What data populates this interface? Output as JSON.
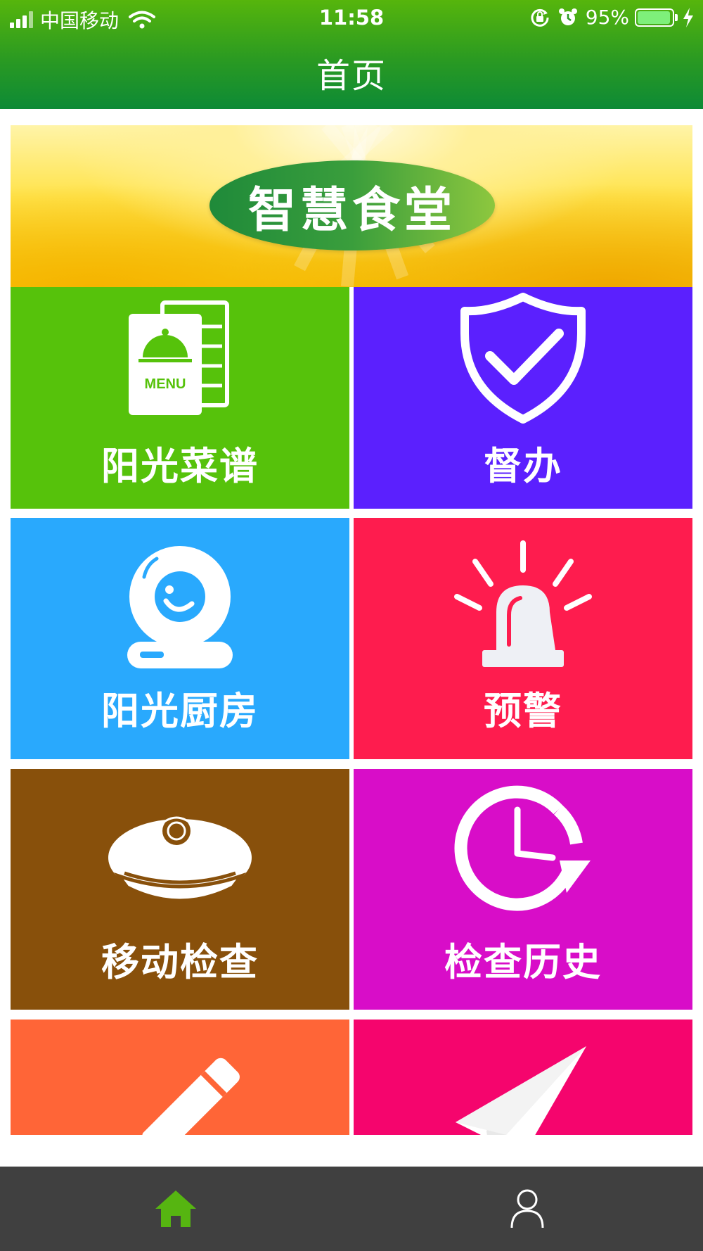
{
  "status_bar": {
    "carrier": "中国移动",
    "time": "11:58",
    "battery_percent": "95%",
    "battery_level": 0.95,
    "icons": [
      "signal-icon",
      "wifi-icon",
      "rotation-lock-icon",
      "alarm-icon",
      "battery-icon",
      "charging-icon"
    ]
  },
  "header": {
    "title": "首页"
  },
  "banner": {
    "text": "智慧食堂",
    "background": "sunflower-yellow"
  },
  "tiles": [
    {
      "label": "阳光菜谱",
      "color": "#56c20b",
      "icon": "menu-icon",
      "menu_text": "MENU"
    },
    {
      "label": "督办",
      "color": "#5b20fe",
      "icon": "shield-check-icon"
    },
    {
      "label": "阳光厨房",
      "color": "#29a9fd",
      "icon": "webcam-icon"
    },
    {
      "label": "预警",
      "color": "#fe1c4e",
      "icon": "alarm-light-icon"
    },
    {
      "label": "移动检查",
      "color": "#88500b",
      "icon": "inspector-cap-icon"
    },
    {
      "label": "检查历史",
      "color": "#d80dc8",
      "icon": "history-clock-icon"
    },
    {
      "label": "",
      "color": "#ff6537",
      "icon": "pencil-icon"
    },
    {
      "label": "",
      "color": "#f5056d",
      "icon": "paper-plane-icon"
    }
  ],
  "tabbar": {
    "items": [
      {
        "icon": "home-icon",
        "active": true,
        "color": "#56b511"
      },
      {
        "icon": "user-icon",
        "active": false,
        "color": "#ffffff"
      }
    ]
  }
}
